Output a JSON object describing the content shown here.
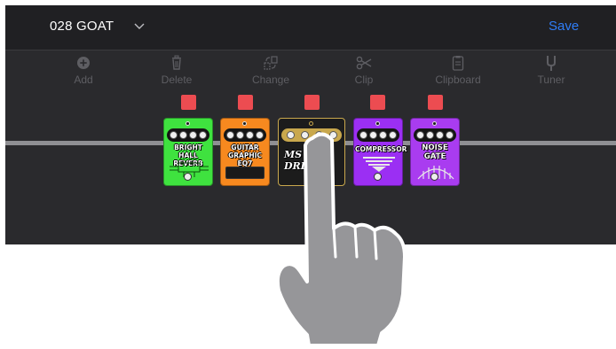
{
  "header": {
    "preset_name": "028 GOAT",
    "save_label": "Save"
  },
  "toolbar": [
    {
      "label": "Add",
      "icon": "add-circle-icon"
    },
    {
      "label": "Delete",
      "icon": "trash-icon"
    },
    {
      "label": "Change",
      "icon": "change-icon"
    },
    {
      "label": "Clip",
      "icon": "scissors-icon"
    },
    {
      "label": "Clipboard",
      "icon": "clipboard-icon"
    },
    {
      "label": "Tuner",
      "icon": "tuning-fork-icon"
    }
  ],
  "chain": {
    "pedals": [
      {
        "label": "BRIGHT HALL REVERB",
        "line1": "BRIGHT HALL",
        "line2": "REVERB",
        "color": "#3fe23f"
      },
      {
        "label": "GUITAR GRAPHIC EQ7",
        "line1": "GUITAR",
        "line2": "GRAPHIC EQ7",
        "color": "#f7891f"
      },
      {
        "label": "MS 800 DRIVE",
        "line1": "MS 800",
        "line2": "DRIVE",
        "color": "#1c1c1c"
      },
      {
        "label": "COMPRESSOR",
        "line1": "COMPRESSOR",
        "line2": "",
        "color": "#9b2ff3"
      },
      {
        "label": "NOISE GATE",
        "line1": "NOISE",
        "line2": "GATE",
        "color": "#a93cf0"
      }
    ],
    "selected_indicator_color": "#ec4c51",
    "cable_color": "#8f8f93"
  },
  "colors": {
    "accent": "#2f7df6",
    "background": "#2a2a2d",
    "toolbar_text": "#5e5e63"
  }
}
